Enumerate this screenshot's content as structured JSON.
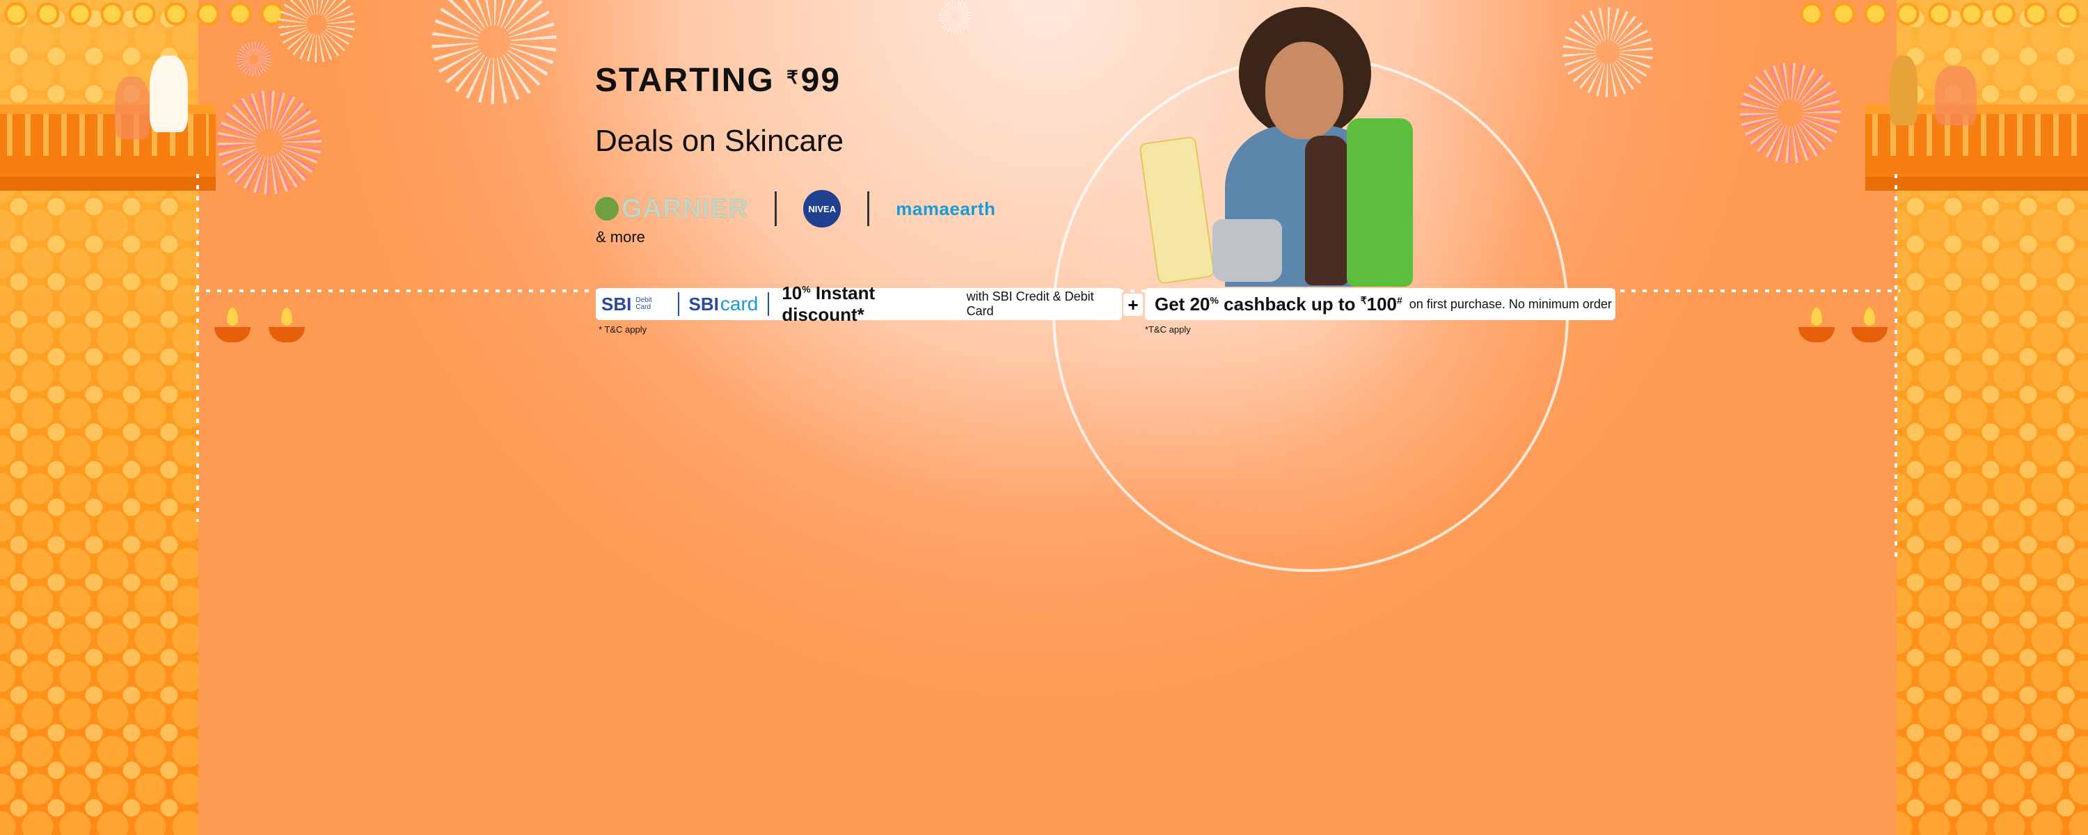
{
  "banner": {
    "headline_prefix": "STARTING ",
    "currency": "₹",
    "price": "99",
    "subheadline": "Deals on Skincare",
    "more_text": "& more"
  },
  "brands": {
    "garnier": "GARNIER",
    "nivea": "NIVEA",
    "mamaearth": "mamaearth"
  },
  "offers": {
    "sbi_debit_mark": "SBI",
    "sbi_debit_sub": "Debit Card",
    "sbi_card_mark": "SBI",
    "sbi_card_text": "card",
    "instant_discount_value": "10",
    "percent_sup": "%",
    "instant_discount_text": " Instant discount*",
    "instant_discount_detail": "with SBI Credit & Debit Card",
    "plus": "+",
    "cashback_prefix": "Get 20",
    "cashback_percent": "%",
    "cashback_mid": " cashback up to ",
    "cashback_currency": "₹",
    "cashback_amount": "100",
    "cashback_hash": "#",
    "cashback_detail": "on first purchase. No minimum order",
    "tnc_1": "* T&C apply",
    "tnc_2": "*T&C apply"
  },
  "colors": {
    "background": "#ff9d55",
    "pillar": "#ff9c1f",
    "headline": "#111111",
    "sbi_blue": "#2a4b9b",
    "sbi_light_blue": "#1a9ad6"
  },
  "icons": [
    "firework-icon",
    "diya-icon",
    "garland-icon"
  ]
}
